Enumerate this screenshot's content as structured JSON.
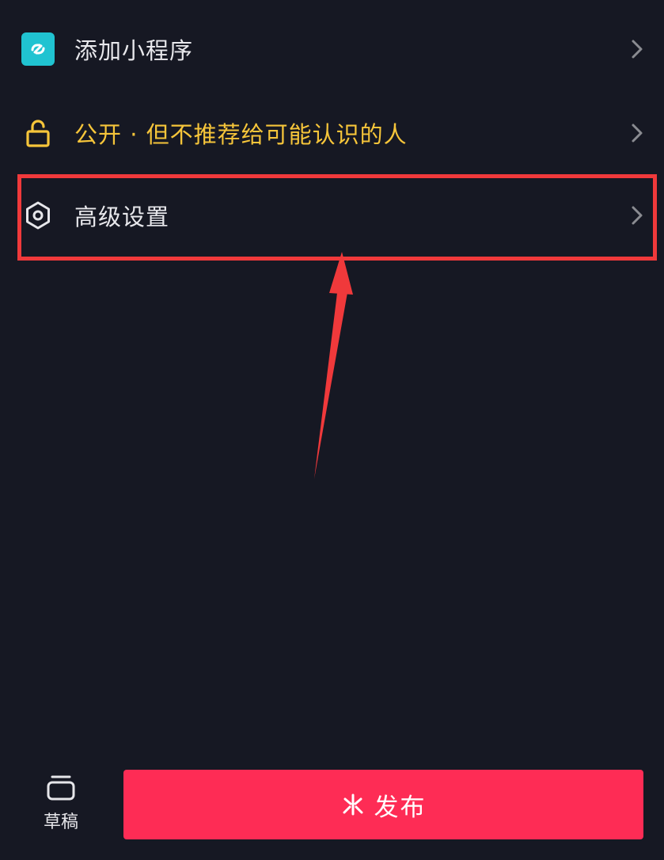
{
  "menu": {
    "mini_program": {
      "label": "添加小程序",
      "icon": "mini-program-icon"
    },
    "privacy": {
      "label": "公开 · 但不推荐给可能认识的人",
      "icon": "unlock-icon"
    },
    "advanced": {
      "label": "高级设置",
      "icon": "hexagon-settings-icon"
    }
  },
  "bottom": {
    "draft_label": "草稿",
    "publish_label": "发布"
  },
  "colors": {
    "background": "#161823",
    "accent_yellow": "#F6C53A",
    "mini_program_teal": "#20C3D1",
    "publish_red": "#FE2C55",
    "annotation_red": "#F0393B"
  }
}
